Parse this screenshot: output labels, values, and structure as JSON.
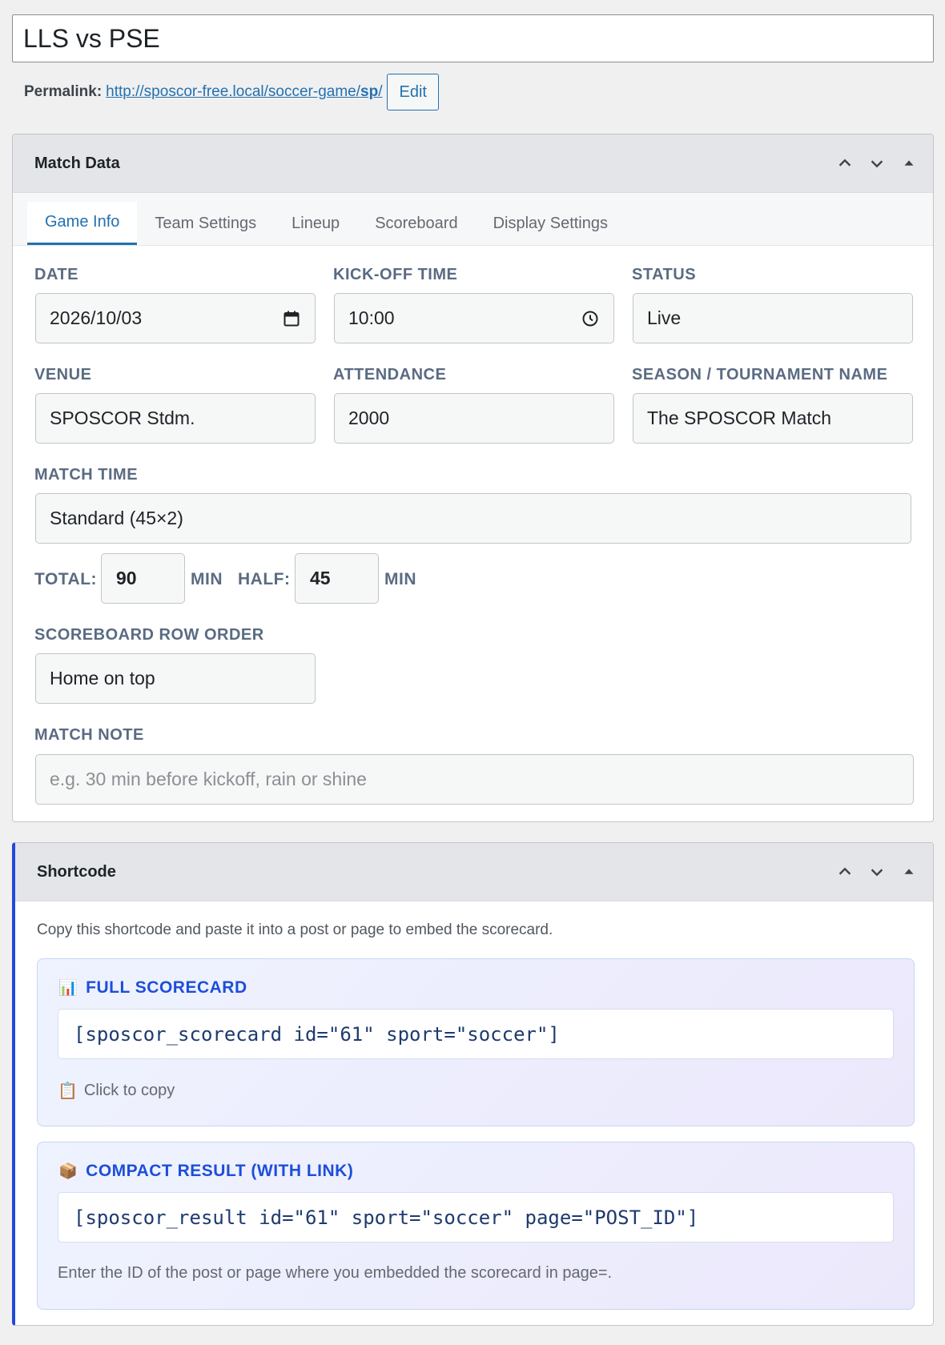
{
  "title": "LLS vs PSE",
  "permalink": {
    "label": "Permalink:",
    "url_prefix": "http://sposcor-free.local/soccer-game/",
    "url_slug": "sp",
    "url_suffix": "/",
    "edit_label": "Edit"
  },
  "match_box": {
    "title": "Match Data",
    "tabs": [
      "Game Info",
      "Team Settings",
      "Lineup",
      "Scoreboard",
      "Display Settings"
    ],
    "active_tab": "Game Info",
    "fields": {
      "date": {
        "label": "DATE",
        "value": "2026/10/03"
      },
      "kickoff": {
        "label": "KICK-OFF TIME",
        "value": "10:00"
      },
      "status": {
        "label": "STATUS",
        "value": "Live"
      },
      "venue": {
        "label": "VENUE",
        "value": "SPOSCOR Stdm."
      },
      "attendance": {
        "label": "ATTENDANCE",
        "value": "2000"
      },
      "season": {
        "label": "SEASON / TOURNAMENT NAME",
        "value": "The SPOSCOR Match"
      },
      "match_time": {
        "label": "MATCH TIME",
        "value": "Standard (45×2)"
      },
      "total_label": "TOTAL:",
      "total_value": "90",
      "min_label_1": "MIN",
      "half_label": "HALF:",
      "half_value": "45",
      "min_label_2": "MIN",
      "row_order": {
        "label": "SCOREBOARD ROW ORDER",
        "value": "Home on top"
      },
      "note": {
        "label": "MATCH NOTE",
        "placeholder": "e.g. 30 min before kickoff, rain or shine"
      }
    }
  },
  "shortcode_box": {
    "title": "Shortcode",
    "intro": "Copy this shortcode and paste it into a post or page to embed the scorecard.",
    "full": {
      "icon": "📊",
      "title": "FULL SCORECARD",
      "code": "[sposcor_scorecard id=\"61\" sport=\"soccer\"]",
      "copy_icon": "📋",
      "copy_label": "Click to copy"
    },
    "compact": {
      "icon": "📦",
      "title": "COMPACT RESULT (WITH LINK)",
      "code": "[sposcor_result id=\"61\" sport=\"soccer\" page=\"POST_ID\"]",
      "note": "Enter the ID of the post or page where you embedded the scorecard in page=."
    }
  }
}
